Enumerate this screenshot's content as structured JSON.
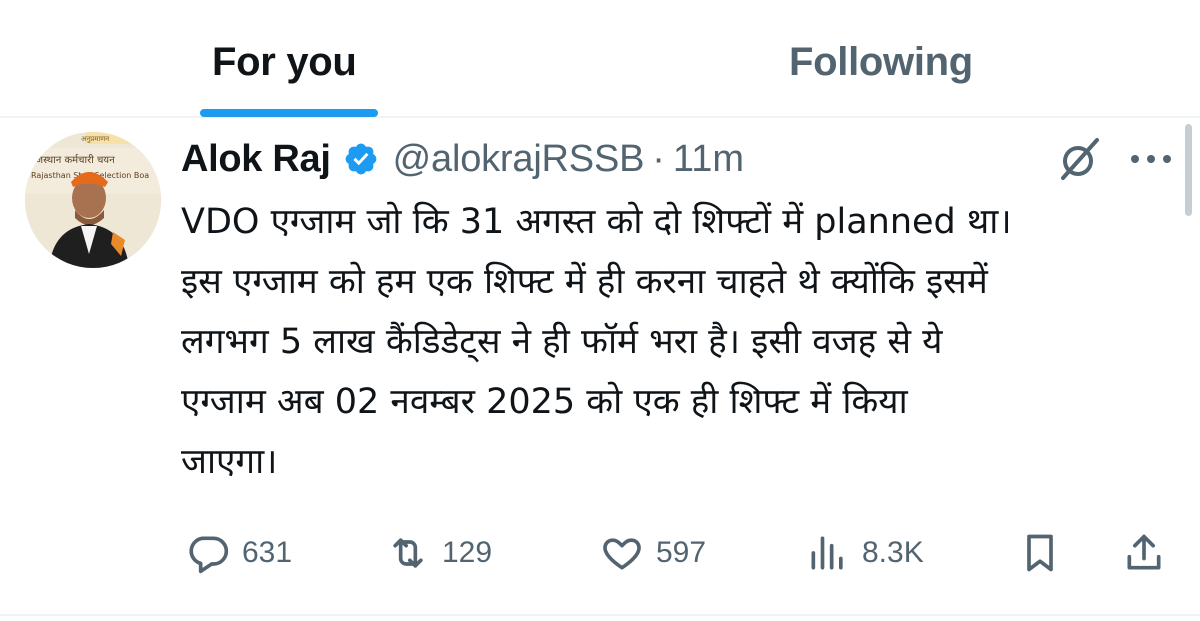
{
  "tabs": [
    {
      "label": "For you",
      "active": true
    },
    {
      "label": "Following",
      "active": false
    }
  ],
  "tweet": {
    "author_name": "Alok Raj",
    "handle": "@alokrajRSSB",
    "separator": "·",
    "time": "11m",
    "text": "VDO एग्जाम जो कि 31 अगस्त को दो शिफ्टों में planned था।\nइस एग्जाम को हम एक शिफ्ट में ही करना चाहते थे क्योंकि इसमें\nलगभग 5 लाख कैंडिडेट्स ने ही फॉर्म भरा है। इसी वजह से ये\nएग्जाम अब 02 नवम्बर 2025 को एक ही शिफ्ट में किया\nजाएगा।",
    "avatar_banner_text_1": "राजस्थान कर्मचारी चयन",
    "avatar_banner_text_2": "Rajasthan Staff Selection Boa",
    "avatar_banner_emblem": "अनुप्रमाणन"
  },
  "actions": {
    "replies": "631",
    "reposts": "129",
    "likes": "597",
    "views": "8.3K"
  },
  "icons": [
    "verified-badge-icon",
    "grok-icon",
    "more-icon",
    "reply-icon",
    "repost-icon",
    "like-icon",
    "views-icon",
    "bookmark-icon",
    "share-icon"
  ],
  "colors": {
    "accent": "#1d9bf0",
    "text_primary": "#0f1419",
    "text_secondary": "#536471",
    "divider": "#eff3f4"
  }
}
